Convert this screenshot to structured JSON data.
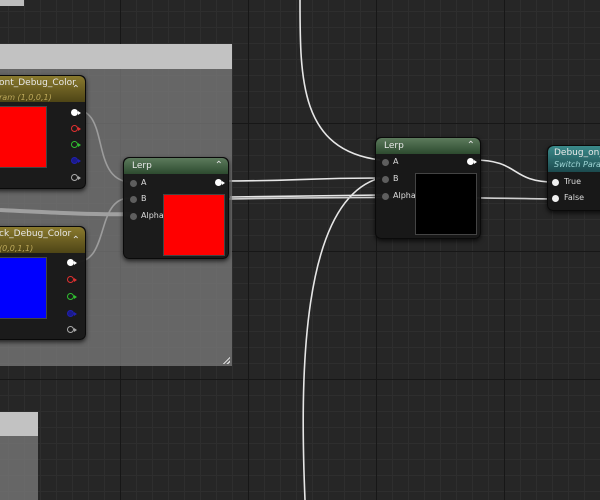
{
  "editor": {
    "lerp_inner": {
      "title": "Lerp",
      "pins": {
        "a": "A",
        "b": "B",
        "alpha": "Alpha"
      },
      "preview_color": "#ff0000"
    },
    "lerp_outer": {
      "title": "Lerp",
      "pins": {
        "a": "A",
        "b": "B",
        "alpha": "Alpha"
      },
      "preview_color": "#000000"
    },
    "front_param": {
      "title": "ont_Debug_Color",
      "subtitle": "ram (1,0,0,1)",
      "preview_color": "#ff0000"
    },
    "back_param": {
      "title": "ck_Debug_Color",
      "subtitle": "(0,0,1,1)",
      "preview_color": "#0000ff"
    },
    "switch_param": {
      "title": "Debug_on_S",
      "subtitle": "Switch Param",
      "pins": {
        "true": "True",
        "false": "False"
      }
    },
    "colors": {
      "canvas": "#262626",
      "wire": "#e6e6e6",
      "node_body": "#181818"
    }
  }
}
